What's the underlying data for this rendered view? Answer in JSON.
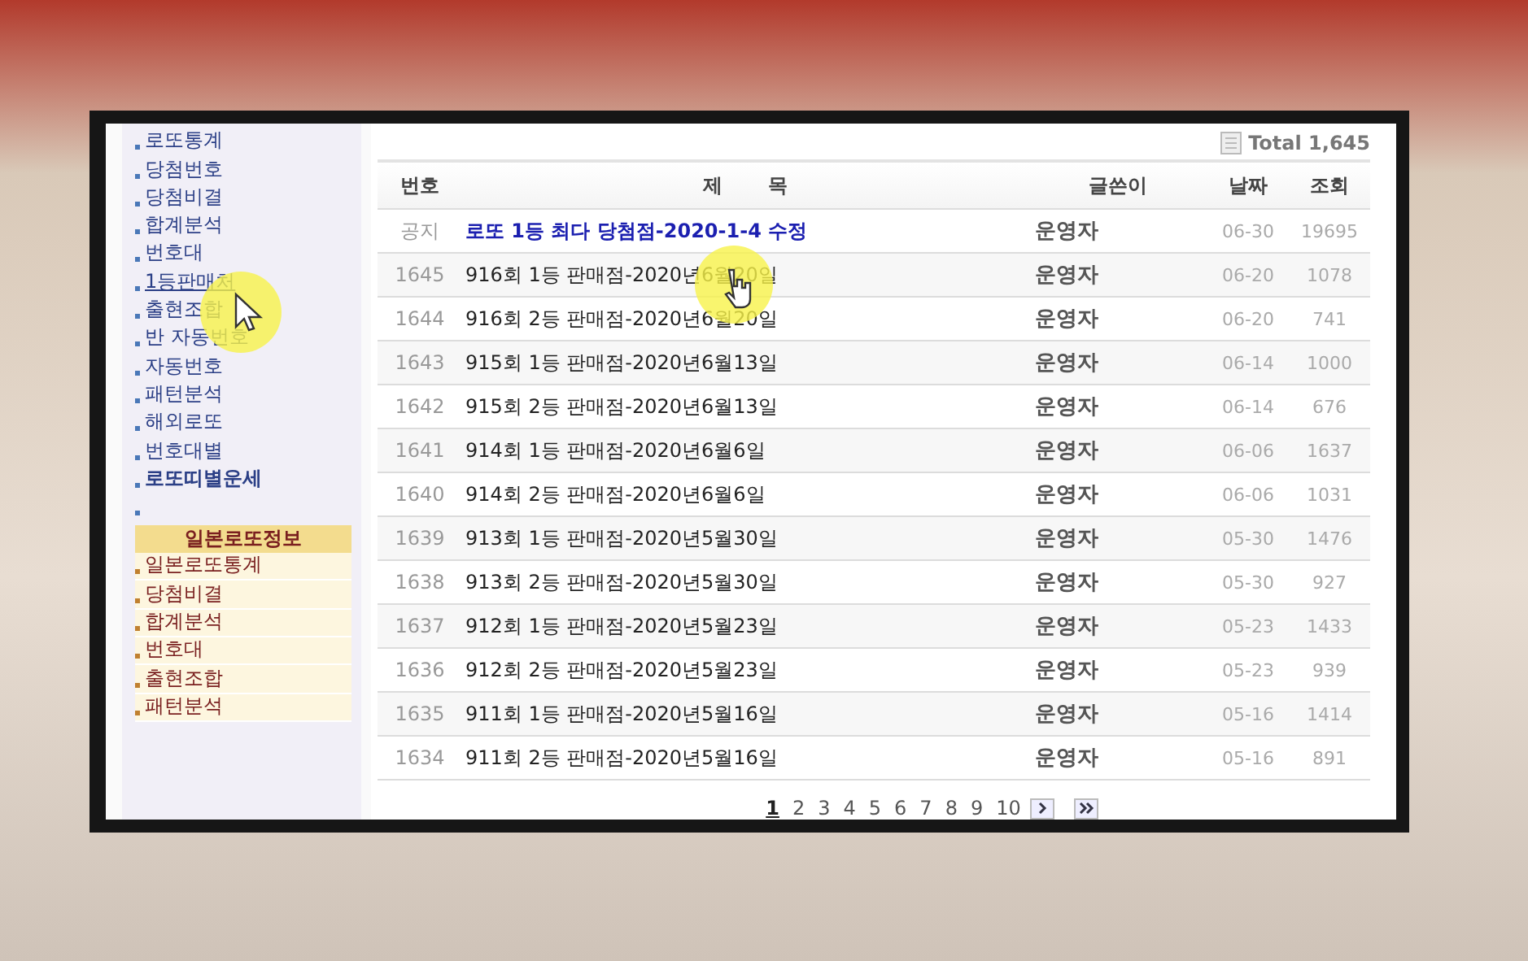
{
  "sidebar": {
    "items": [
      {
        "label": "로또통계",
        "kind": "link",
        "hovered": false,
        "bold": false
      },
      {
        "label": "당첨번호",
        "kind": "link",
        "hovered": false,
        "bold": false
      },
      {
        "label": "당첨비결",
        "kind": "link",
        "hovered": false,
        "bold": false
      },
      {
        "label": "합계분석",
        "kind": "link",
        "hovered": false,
        "bold": false
      },
      {
        "label": "번호대",
        "kind": "link",
        "hovered": false,
        "bold": false
      },
      {
        "label": "1등판매처",
        "kind": "link",
        "hovered": true,
        "bold": false
      },
      {
        "label": "출현조합",
        "kind": "link",
        "hovered": false,
        "bold": false
      },
      {
        "label": "반 자동번호",
        "kind": "link",
        "hovered": false,
        "bold": false
      },
      {
        "label": "자동번호",
        "kind": "link",
        "hovered": false,
        "bold": false
      },
      {
        "label": "패턴분석",
        "kind": "link",
        "hovered": false,
        "bold": false
      },
      {
        "label": "해외로또",
        "kind": "link",
        "hovered": false,
        "bold": false
      },
      {
        "label": "번호대별",
        "kind": "link",
        "hovered": false,
        "bold": false
      },
      {
        "label": "로또띠별운세",
        "kind": "link",
        "hovered": false,
        "bold": true
      },
      {
        "kind": "spacer"
      }
    ],
    "section_title": "일본로또정보",
    "section_items": [
      {
        "label": "일본로또통계"
      },
      {
        "label": "당첨비결"
      },
      {
        "label": "합계분석"
      },
      {
        "label": "번호대"
      },
      {
        "label": "출현조합"
      },
      {
        "label": "패턴분석"
      }
    ]
  },
  "board": {
    "total_label": "Total 1,645",
    "columns": [
      "번호",
      "제 목",
      "글쓴이",
      "날짜",
      "조회"
    ],
    "rows": [
      {
        "kind": "notice",
        "number": "공지",
        "title": "로또 1등 최다 당첨점-2020-1-4 수정",
        "author": "운영자",
        "date": "06-30",
        "views": "19695"
      },
      {
        "kind": "post",
        "number": "1645",
        "title": "916회 1등 판매점-2020년6월20일",
        "author": "운영자",
        "date": "06-20",
        "views": "1078"
      },
      {
        "kind": "post",
        "number": "1644",
        "title": "916회 2등 판매점-2020년6월20일",
        "author": "운영자",
        "date": "06-20",
        "views": "741"
      },
      {
        "kind": "post",
        "number": "1643",
        "title": "915회 1등 판매점-2020년6월13일",
        "author": "운영자",
        "date": "06-14",
        "views": "1000"
      },
      {
        "kind": "post",
        "number": "1642",
        "title": "915회 2등 판매점-2020년6월13일",
        "author": "운영자",
        "date": "06-14",
        "views": "676"
      },
      {
        "kind": "post",
        "number": "1641",
        "title": "914회 1등 판매점-2020년6월6일",
        "author": "운영자",
        "date": "06-06",
        "views": "1637"
      },
      {
        "kind": "post",
        "number": "1640",
        "title": "914회 2등 판매점-2020년6월6일",
        "author": "운영자",
        "date": "06-06",
        "views": "1031"
      },
      {
        "kind": "post",
        "number": "1639",
        "title": "913회 1등 판매점-2020년5월30일",
        "author": "운영자",
        "date": "05-30",
        "views": "1476"
      },
      {
        "kind": "post",
        "number": "1638",
        "title": "913회 2등 판매점-2020년5월30일",
        "author": "운영자",
        "date": "05-30",
        "views": "927"
      },
      {
        "kind": "post",
        "number": "1637",
        "title": "912회 1등 판매점-2020년5월23일",
        "author": "운영자",
        "date": "05-23",
        "views": "1433"
      },
      {
        "kind": "post",
        "number": "1636",
        "title": "912회 2등 판매점-2020년5월23일",
        "author": "운영자",
        "date": "05-23",
        "views": "939"
      },
      {
        "kind": "post",
        "number": "1635",
        "title": "911회 1등 판매점-2020년5월16일",
        "author": "운영자",
        "date": "05-16",
        "views": "1414"
      },
      {
        "kind": "post",
        "number": "1634",
        "title": "911회 2등 판매점-2020년5월16일",
        "author": "운영자",
        "date": "05-16",
        "views": "891"
      }
    ],
    "pages": [
      {
        "label": "1",
        "selected": true
      },
      {
        "label": "2",
        "selected": false
      },
      {
        "label": "3",
        "selected": false
      },
      {
        "label": "4",
        "selected": false
      },
      {
        "label": "5",
        "selected": false
      },
      {
        "label": "6",
        "selected": false
      },
      {
        "label": "7",
        "selected": false
      },
      {
        "label": "8",
        "selected": false
      },
      {
        "label": "9",
        "selected": false
      },
      {
        "label": "10",
        "selected": false
      }
    ]
  }
}
